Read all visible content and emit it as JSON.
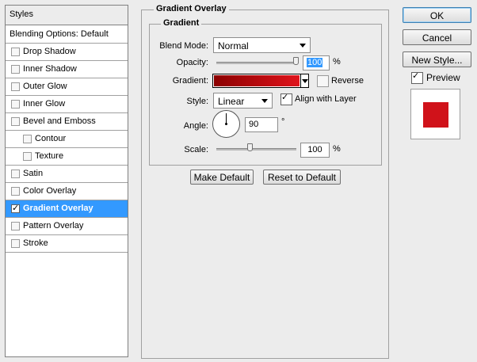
{
  "styles_panel": {
    "header": "Styles",
    "items": [
      {
        "label": "Blending Options: Default",
        "has_checkbox": false,
        "checked": false,
        "indent": false,
        "selected": false,
        "bold": false
      },
      {
        "label": "Drop Shadow",
        "has_checkbox": true,
        "checked": false,
        "indent": false,
        "selected": false
      },
      {
        "label": "Inner Shadow",
        "has_checkbox": true,
        "checked": false,
        "indent": false,
        "selected": false
      },
      {
        "label": "Outer Glow",
        "has_checkbox": true,
        "checked": false,
        "indent": false,
        "selected": false
      },
      {
        "label": "Inner Glow",
        "has_checkbox": true,
        "checked": false,
        "indent": false,
        "selected": false
      },
      {
        "label": "Bevel and Emboss",
        "has_checkbox": true,
        "checked": false,
        "indent": false,
        "selected": false
      },
      {
        "label": "Contour",
        "has_checkbox": true,
        "checked": false,
        "indent": true,
        "selected": false
      },
      {
        "label": "Texture",
        "has_checkbox": true,
        "checked": false,
        "indent": true,
        "selected": false
      },
      {
        "label": "Satin",
        "has_checkbox": true,
        "checked": false,
        "indent": false,
        "selected": false
      },
      {
        "label": "Color Overlay",
        "has_checkbox": true,
        "checked": false,
        "indent": false,
        "selected": false
      },
      {
        "label": "Gradient Overlay",
        "has_checkbox": true,
        "checked": true,
        "indent": false,
        "selected": true
      },
      {
        "label": "Pattern Overlay",
        "has_checkbox": true,
        "checked": false,
        "indent": false,
        "selected": false
      },
      {
        "label": "Stroke",
        "has_checkbox": true,
        "checked": false,
        "indent": false,
        "selected": false
      }
    ]
  },
  "gradient_overlay": {
    "group_title": "Gradient Overlay",
    "subgroup_title": "Gradient",
    "blend_mode": {
      "label": "Blend Mode:",
      "value": "Normal"
    },
    "opacity": {
      "label": "Opacity:",
      "value": "100",
      "unit": "%",
      "slider_fraction": 1.0
    },
    "gradient": {
      "label": "Gradient:",
      "start_color": "#8b0000",
      "end_color": "#e0141c"
    },
    "reverse": {
      "label": "Reverse",
      "checked": false
    },
    "style": {
      "label": "Style:",
      "value": "Linear"
    },
    "align_with_layer": {
      "label": "Align with Layer",
      "checked": true
    },
    "angle": {
      "label": "Angle:",
      "value": "90",
      "unit": "°",
      "degrees": 90
    },
    "scale": {
      "label": "Scale:",
      "value": "100",
      "unit": "%",
      "slider_fraction": 0.43
    },
    "make_default_label": "Make Default",
    "reset_to_default_label": "Reset to Default"
  },
  "dialog_buttons": {
    "ok_label": "OK",
    "cancel_label": "Cancel",
    "new_style_label": "New Style...",
    "preview_label": "Preview",
    "preview_checked": true
  },
  "colors": {
    "selection_blue": "#3399ff",
    "preview_swatch": "#d0121a",
    "dialog_background": "#ececec"
  }
}
